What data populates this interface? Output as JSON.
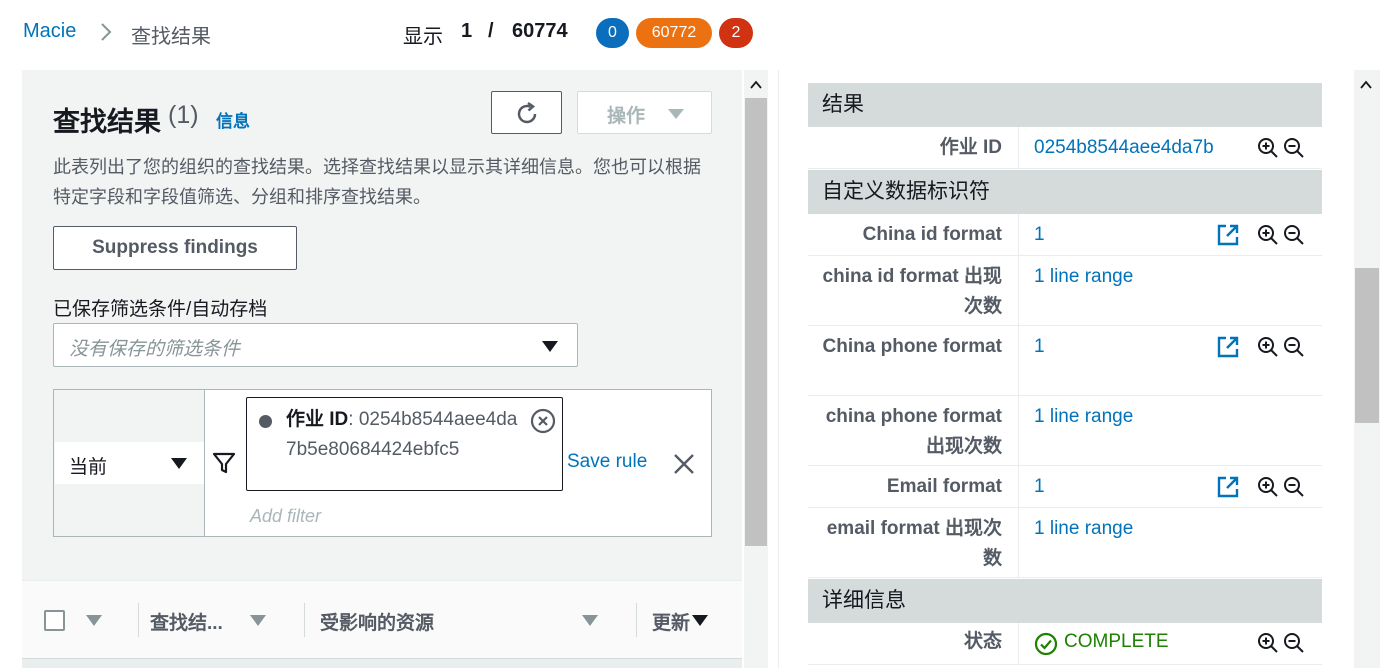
{
  "breadcrumb": {
    "root": "Macie",
    "current": "查找结果"
  },
  "pager": {
    "label": "显示",
    "current": "1",
    "slash": "/",
    "total": "60774"
  },
  "severity_badges": {
    "blue": "0",
    "orange": "60772",
    "red": "2"
  },
  "left_panel": {
    "title": "查找结果",
    "count": "(1)",
    "info_link": "信息",
    "actions_label": "操作",
    "description": "此表列出了您的组织的查找结果。选择查找结果以显示其详细信息。您也可以根据特定字段和字段值筛选、分组和排序查找结果。",
    "suppress_label": "Suppress findings",
    "saved_filters_label": "已保存筛选条件/自动存档",
    "saved_filters_placeholder": "没有保存的筛选条件",
    "filter": {
      "scope": "当前",
      "token_key": "作业 ID",
      "token_value": ": 0254b8544aee4da7b5e80684424ebfc5",
      "save_rule": "Save rule",
      "add_filter_placeholder": "Add filter"
    },
    "table_headers": [
      "查找结...",
      "受影响的资源",
      "更新"
    ]
  },
  "right_panel": {
    "section_result": "结果",
    "job_id_key": "作业 ID",
    "job_id_value": "0254b8544aee4da7b",
    "section_custom": "自定义数据标识符",
    "custom_rows": [
      {
        "key": "China id format",
        "value": "1"
      },
      {
        "key": "china id format 出现次数",
        "value": "1 line range"
      },
      {
        "key": "China phone format",
        "value": "1"
      },
      {
        "key": "china phone format 出现次数",
        "value": "1 line range"
      },
      {
        "key": "Email format",
        "value": "1"
      },
      {
        "key": "email format 出现次数",
        "value": "1 line range"
      }
    ],
    "section_details": "详细信息",
    "status_key": "状态",
    "status_value": "COMPLETE"
  },
  "colors": {
    "link": "#0073bb",
    "success": "#1d8102",
    "badge_blue": "#0a6ebd",
    "badge_orange": "#ec7211",
    "badge_red": "#d13212"
  }
}
